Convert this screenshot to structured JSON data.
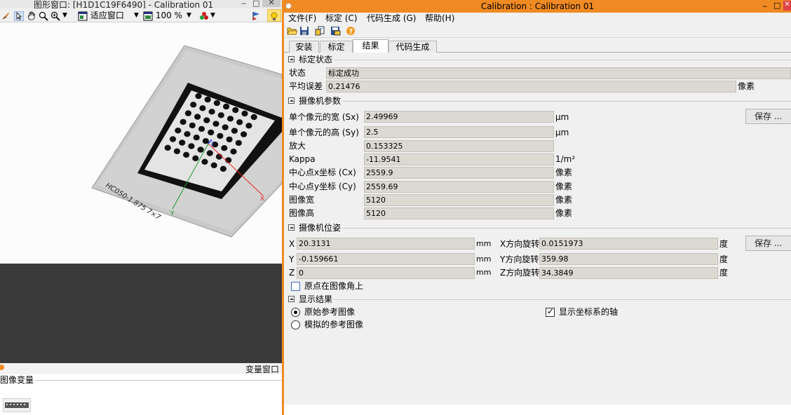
{
  "graphics_window": {
    "title": "图形窗口: [H1D1C19F6490] - Calibration 01",
    "toolbar": {
      "fit_window_label": "适应窗口",
      "zoom_label": "100 %"
    },
    "image": {
      "plate_text": "HC050-1.875  7×7",
      "axis_x_label": "X",
      "axis_y_label": "Y",
      "axis_z_label": "Z"
    }
  },
  "variable_window": {
    "title": "变量窗口",
    "section_label": "图像变量"
  },
  "dialog": {
    "title": "Calibration : Calibration 01",
    "menu": [
      "文件(F)",
      "标定 (C)",
      "代码生成 (G)",
      "帮助(H)"
    ],
    "tabs": [
      "安装",
      "标定",
      "结果",
      "代码生成"
    ],
    "active_tab": "结果",
    "status_group": {
      "title": "标定状态",
      "status_label": "状态",
      "status_value": "标定成功",
      "error_label": "平均误差",
      "error_value": "0.21476",
      "error_unit": "像素"
    },
    "camera_group": {
      "title": "摄像机参数",
      "save_label": "保存 ...",
      "rows": [
        {
          "label": "单个像元的宽 (Sx)",
          "value": "2.49969",
          "unit": "μm"
        },
        {
          "label": "单个像元的高 (Sy)",
          "value": "2.5",
          "unit": "μm"
        },
        {
          "label": "放大",
          "value": "0.153325",
          "unit": ""
        },
        {
          "label": "Kappa",
          "value": "-11.9541",
          "unit": "1/m²"
        },
        {
          "label": "中心点x坐标 (Cx)",
          "value": "2559.9",
          "unit": "像素"
        },
        {
          "label": "中心点y坐标 (Cy)",
          "value": "2559.69",
          "unit": "像素"
        },
        {
          "label": "图像宽",
          "value": "5120",
          "unit": "像素"
        },
        {
          "label": "图像高",
          "value": "5120",
          "unit": "像素"
        }
      ]
    },
    "pose_group": {
      "title": "摄像机位姿",
      "save_label": "保存 ...",
      "rows": [
        {
          "label": "X",
          "value": "20.3131",
          "unit": "mm",
          "rot_label": "X方向旋转",
          "rot_value": "0.0151973",
          "rot_unit": "度"
        },
        {
          "label": "Y",
          "value": "-0.159661",
          "unit": "mm",
          "rot_label": "Y方向旋转",
          "rot_value": "359.98",
          "rot_unit": "度"
        },
        {
          "label": "Z",
          "value": "0",
          "unit": "mm",
          "rot_label": "Z方向旋转",
          "rot_value": "34.3849",
          "rot_unit": "度"
        }
      ],
      "origin_checkbox_label": "原点在图像角上"
    },
    "display_group": {
      "title": "显示结果",
      "radio_original": "原始参考图像",
      "radio_simulated": "模拟的参考图像",
      "show_axes_label": "显示坐标系的轴"
    }
  },
  "colors": {
    "accent_orange": "#f08a22",
    "field_bg": "#dcd8d2",
    "dark_area": "#3a3a3a"
  }
}
